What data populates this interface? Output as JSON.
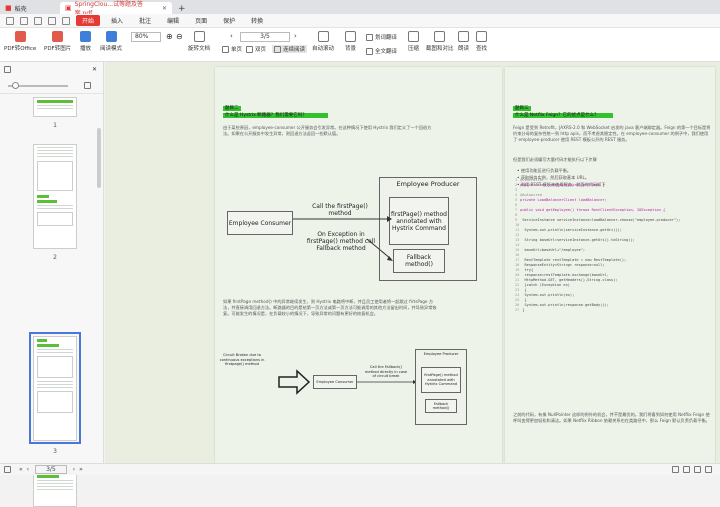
{
  "tabs": {
    "home": "稻壳",
    "doc": "SpringClou...试等题及答案.pdf",
    "add": "+"
  },
  "menu": {
    "items": [
      "开始",
      "插入",
      "批注",
      "编辑",
      "页面",
      "保护",
      "转换"
    ],
    "active": "开始"
  },
  "toolbar": {
    "pdf_office": "PDF转Office",
    "pdf_image": "PDF转图片",
    "play": "播放",
    "read_mode": "阅读模式",
    "zoom": "80%",
    "page": "3",
    "page_total": "/5",
    "rotate": "旋转文档",
    "single": "单页",
    "double": "双页",
    "continuous": "连续阅读",
    "auto_scroll": "自动滚动",
    "background": "背景",
    "word_translate": "划词翻译",
    "full_translate": "全文翻译",
    "compress": "压缩",
    "screenshot": "截图和对比",
    "read": "朗读",
    "search": "查找"
  },
  "sidebar": {
    "page_numbers": [
      "1",
      "2",
      "3"
    ]
  },
  "page1": {
    "label": "题目二",
    "heading": "什么是 Hystrix 断路器？我们需要它吗？",
    "para1": "由于某些原因，employee-consumer 公开服务会引发异常。在这种情况下使用 Hystrix 我们定义了一个回退方法。如果在公开服务中发生异常，则回退方法返回一些默认值。",
    "diagram": {
      "producer_title": "Employee Producer",
      "consumer": "Employee Consumer",
      "call": "Call the firstPage() method",
      "annotated": "firstPage() method annotated with Hystrix Command",
      "exception": "On Exception in firstPage() method call Fallback method",
      "fallback": "Fallback method()"
    },
    "para2": "如果 firstPage method() 中的异常继续发生，则 Hystrix 电路将中断，并且员工使用者将一起跳过 firtsPage 方法，并直接调用回退方法。断路器的目的是给第一页方法或第一页方法可能调用的其他方法留出时间，并导致异常恢复。可能发生的情况是，在负载较小的情况下，导致异常的问题有更好的恢复机会。",
    "diagram2": {
      "circuit": "Circuit Broken due to continuous exceptions in firstpage() method",
      "producer": "Employee Producer",
      "consumer": "Employee Consumer",
      "call_fallback": "Call the Fallback() method directly in case of circuit break",
      "annotated": "firstPage() method annotated with Hystrix Command",
      "fallback": "Fallback method()"
    }
  },
  "page2": {
    "label": "题目三",
    "heading": "什么是 Netflix Feign？它的优点是什么？",
    "para1": "Feign 是受到 Retrofit，JAXRS-2.0 和 WebSocket 启发的 java 客户端绑定器。Feign 的第一个目标是将约束分母的复杂性统一到 http apis，而不考虑其稳定性。在 employee-consumer 的例子中，我们使用了 employee-producer 使用 REST 模板公开的 REST 服务。",
    "para2": "但是我们必须编写大量代码才能执行以下步骤",
    "bullets": [
      "使用功能区进行负载平衡。",
      "获取服务实例，然后获取基本 URL。",
      "利用 REST 模板来使用服务。前面的代码如下"
    ],
    "code": [
      "@Controller",
      "public class ConsumerControllerClient {",
      "",
      "@Autowired",
      "private LoadBalancerClient loadBalancer;",
      "",
      "public void getEmployee() throws RestClientException, IOException {",
      "",
      "    ServiceInstance serviceInstance=loadBalancer.choose(\"employee-producer\");",
      "",
      "    System.out.println(serviceInstance.getUri());",
      "",
      "    String baseUrl=serviceInstance.getUri().toString();",
      "",
      "    baseUrl=baseUrl+\"/employee\";",
      "",
      "    RestTemplate restTemplate = new RestTemplate();",
      "    ResponseEntity<String> response=null;",
      "    try{",
      "    response=restTemplate.exchange(baseUrl,",
      "            HttpMethod.GET, getHeaders(),String.class);",
      "    }catch (Exception ex)",
      "    {",
      "        System.out.println(ex);",
      "    }",
      "    System.out.println(response.getBody());",
      "}"
    ],
    "para3": "之前的代码，有像 NullPointer 这样的例外的机会，并不是最优的。我们将看到如何使用 Netflix Feign 使呼叫变得更加轻松和清洁。如果 Netflix Ribbon 依赖关系也在类路径中，那么 Feign 默认负责负载平衡。"
  },
  "statusbar": {
    "page": "3",
    "total": "/5"
  },
  "colors": {
    "accent": "#e53935",
    "highlight": "#35c02f",
    "selection": "#4a76d9"
  }
}
